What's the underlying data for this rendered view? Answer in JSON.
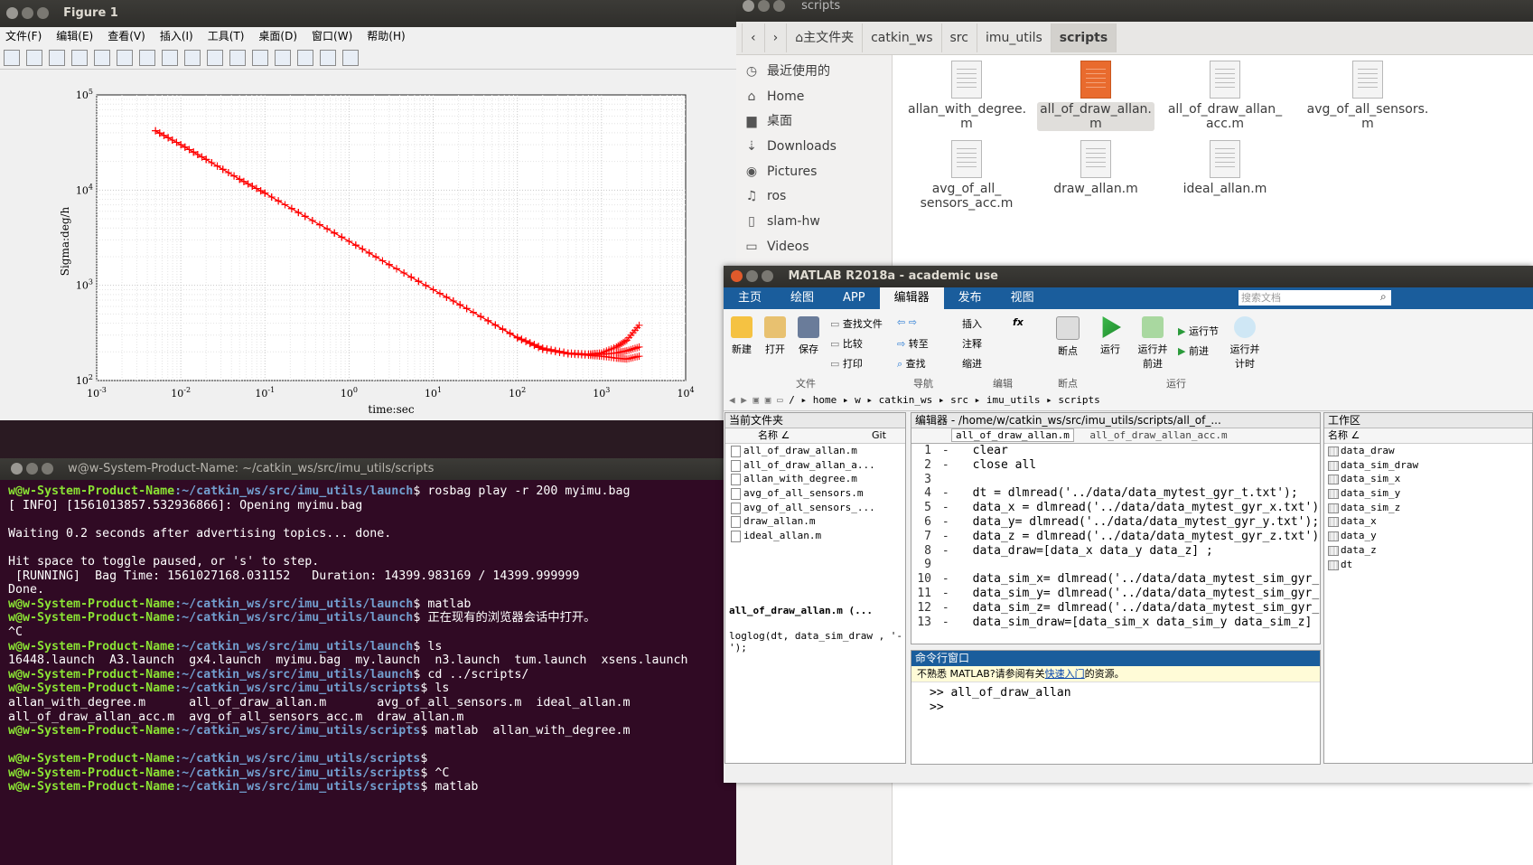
{
  "figure": {
    "title": "Figure 1",
    "menu": [
      "文件(F)",
      "编辑(E)",
      "查看(V)",
      "插入(I)",
      "工具(T)",
      "桌面(D)",
      "窗口(W)",
      "帮助(H)"
    ],
    "xlabel": "time:sec",
    "ylabel": "Sigma:deg/h"
  },
  "chart_data": {
    "type": "line",
    "scale": "loglog",
    "xlabel": "time:sec",
    "ylabel": "Sigma:deg/h",
    "xlim": [
      0.001,
      10000
    ],
    "ylim": [
      100,
      100000
    ],
    "x_tick_labels": [
      "10-3",
      "10-2",
      "10-1",
      "100",
      "101",
      "102",
      "103",
      "104"
    ],
    "y_tick_labels": [
      "102",
      "103",
      "104",
      "105"
    ],
    "grid": true,
    "marker": "+",
    "color": "#ff0000",
    "series": [
      {
        "x": [
          0.005,
          0.01,
          0.02,
          0.05,
          0.1,
          0.3,
          1,
          3,
          10,
          30,
          100,
          200,
          400,
          700,
          1000,
          1500,
          2000,
          2800
        ],
        "y": [
          42000,
          30000,
          21000,
          13000,
          9300,
          5300,
          2900,
          1650,
          900,
          520,
          285,
          220,
          195,
          190,
          195,
          225,
          265,
          380
        ]
      },
      {
        "x": [
          0.005,
          0.01,
          0.02,
          0.05,
          0.1,
          0.3,
          1,
          3,
          10,
          30,
          100,
          200,
          400,
          700,
          1000,
          1500,
          2000,
          2800
        ],
        "y": [
          42000,
          30000,
          21000,
          13000,
          9300,
          5300,
          2900,
          1650,
          900,
          520,
          280,
          215,
          192,
          188,
          188,
          195,
          205,
          225
        ]
      },
      {
        "x": [
          0.005,
          0.01,
          0.02,
          0.05,
          0.1,
          0.3,
          1,
          3,
          10,
          30,
          100,
          200,
          400,
          700,
          1000,
          1500,
          2000,
          2800
        ],
        "y": [
          42000,
          30000,
          21000,
          13000,
          9300,
          5300,
          2900,
          1650,
          900,
          520,
          282,
          212,
          190,
          184,
          180,
          172,
          168,
          180
        ]
      }
    ]
  },
  "file_manager": {
    "title": "scripts",
    "breadcrumb": [
      "主文件夹",
      "catkin_ws",
      "src",
      "imu_utils",
      "scripts"
    ],
    "sidebar": [
      "最近使用的",
      "Home",
      "桌面",
      "Downloads",
      "Pictures",
      "ros",
      "slam-hw",
      "Videos"
    ],
    "sidebar_icons": [
      "◷",
      "⌂",
      "▆",
      "⇣",
      "◉",
      "♫",
      "▯",
      "▭"
    ],
    "files": [
      {
        "l1": "allan_with_degree.",
        "l2": "m"
      },
      {
        "l1": "all_of_draw_allan.",
        "l2": "m"
      },
      {
        "l1": "all_of_draw_allan_",
        "l2": "acc.m"
      },
      {
        "l1": "avg_of_all_sensors.",
        "l2": "m"
      },
      {
        "l1": "avg_of_all_",
        "l2": "sensors_acc.m"
      },
      {
        "l1": "draw_allan.m",
        "l2": ""
      },
      {
        "l1": "ideal_allan.m",
        "l2": ""
      }
    ]
  },
  "terminal": {
    "title": "w@w-System-Product-Name: ~/catkin_ws/src/imu_utils/scripts",
    "prompt_user": "w@w-System-Product-Name",
    "path_launch": ":~/catkin_ws/src/imu_utils/launch",
    "path_scripts": ":~/catkin_ws/src/imu_utils/scripts",
    "cmd1": "$ rosbag play -r 200 myimu.bag",
    "out1": "[ INFO] [1561013857.532936866]: Opening myimu.bag",
    "out2": "Waiting 0.2 seconds after advertising topics... done.",
    "out3": "Hit space to toggle paused, or 's' to step.",
    "out4": " [RUNNING]  Bag Time: 1561027168.031152   Duration: 14399.983169 / 14399.999999",
    "out5": "Done.",
    "cmd2": "$ matlab",
    "cmd3": "$ 正在现有的浏览器会话中打开。",
    "out6": "^C",
    "cmd4": "$ ls",
    "out7": "16448.launch  A3.launch  gx4.launch  myimu.bag  my.launch  n3.launch  tum.launch  xsens.launch",
    "cmd5": "$ cd ../scripts/",
    "cmd6": "$ ls",
    "out8": "allan_with_degree.m      all_of_draw_allan.m       avg_of_all_sensors.m  ideal_allan.m",
    "out9": "all_of_draw_allan_acc.m  avg_of_all_sensors_acc.m  draw_allan.m",
    "cmd7": "$ matlab  allan_with_degree.m",
    "cmd8": "$",
    "cmd9": "$ ^C",
    "cmd10": "$ matlab"
  },
  "matlab": {
    "title": "MATLAB R2018a - academic use",
    "tabs": [
      "主页",
      "绘图",
      "APP",
      "编辑器",
      "发布",
      "视图"
    ],
    "search_placeholder": "搜索文档",
    "ribbon": {
      "new": "新建",
      "open": "打开",
      "save": "保存",
      "find_files": "查找文件",
      "compare": "比较",
      "print": "打印",
      "insert": "插入",
      "fx": "fx",
      "goto": "转至",
      "comment": "注释",
      "find": "查找",
      "indent": "缩进",
      "breakpoint": "断点",
      "run": "运行",
      "run_adv1": "运行并",
      "run_adv2": "前进",
      "run_section": "运行节",
      "advance": "前进",
      "run_time1": "运行并",
      "run_time2": "计时",
      "sec_file": "文件",
      "sec_nav": "导航",
      "sec_edit": "编辑",
      "sec_bp": "断点",
      "sec_run": "运行"
    },
    "address": [
      "/",
      "home",
      "w",
      "catkin_ws",
      "src",
      "imu_utils",
      "scripts"
    ],
    "current_folder": {
      "title": "当前文件夹",
      "col_name": "名称 ∠",
      "col_git": "Git",
      "files": [
        "all_of_draw_allan.m",
        "all_of_draw_allan_a...",
        "allan_with_degree.m",
        "avg_of_all_sensors.m",
        "avg_of_all_sensors_...",
        "draw_allan.m",
        "ideal_allan.m"
      ],
      "detail_name": "all_of_draw_allan.m  (...",
      "detail_code": "loglog(dt, data_sim_draw , '-');"
    },
    "editor": {
      "header": "编辑器 - /home/w/catkin_ws/src/imu_utils/scripts/all_of_...",
      "tab1": "all_of_draw_allan.m",
      "tab2": "all_of_draw_allan_acc.m",
      "lines": [
        {
          "n": "1",
          "t": "  clear"
        },
        {
          "n": "2",
          "t": "  close all"
        },
        {
          "n": "3",
          "t": ""
        },
        {
          "n": "4",
          "t": "  dt = dlmread('../data/data_mytest_gyr_t.txt');"
        },
        {
          "n": "5",
          "t": "  data_x = dlmread('../data/data_mytest_gyr_x.txt');"
        },
        {
          "n": "6",
          "t": "  data_y= dlmread('../data/data_mytest_gyr_y.txt');"
        },
        {
          "n": "7",
          "t": "  data_z = dlmread('../data/data_mytest_gyr_z.txt');"
        },
        {
          "n": "8",
          "t": "  data_draw=[data_x data_y data_z] ;"
        },
        {
          "n": "9",
          "t": ""
        },
        {
          "n": "10",
          "t": "  data_sim_x= dlmread('../data/data_mytest_sim_gyr_"
        },
        {
          "n": "11",
          "t": "  data_sim_y= dlmread('../data/data_mytest_sim_gyr_"
        },
        {
          "n": "12",
          "t": "  data_sim_z= dlmread('../data/data_mytest_sim_gyr_"
        },
        {
          "n": "13",
          "t": "  data_sim_draw=[data_sim_x data_sim_y data_sim_z]"
        }
      ]
    },
    "command": {
      "title": "命令行窗口",
      "notice_pre": "不熟悉 MATLAB?请参阅有关",
      "notice_link": "快速入门",
      "notice_post": "的资源。",
      "line1": ">> all_of_draw_allan",
      "line2": ">>"
    },
    "workspace": {
      "title": "工作区",
      "col_name": "名称 ∠",
      "vars": [
        "data_draw",
        "data_sim_draw",
        "data_sim_x",
        "data_sim_y",
        "data_sim_z",
        "data_x",
        "data_y",
        "data_z",
        "dt"
      ]
    }
  }
}
